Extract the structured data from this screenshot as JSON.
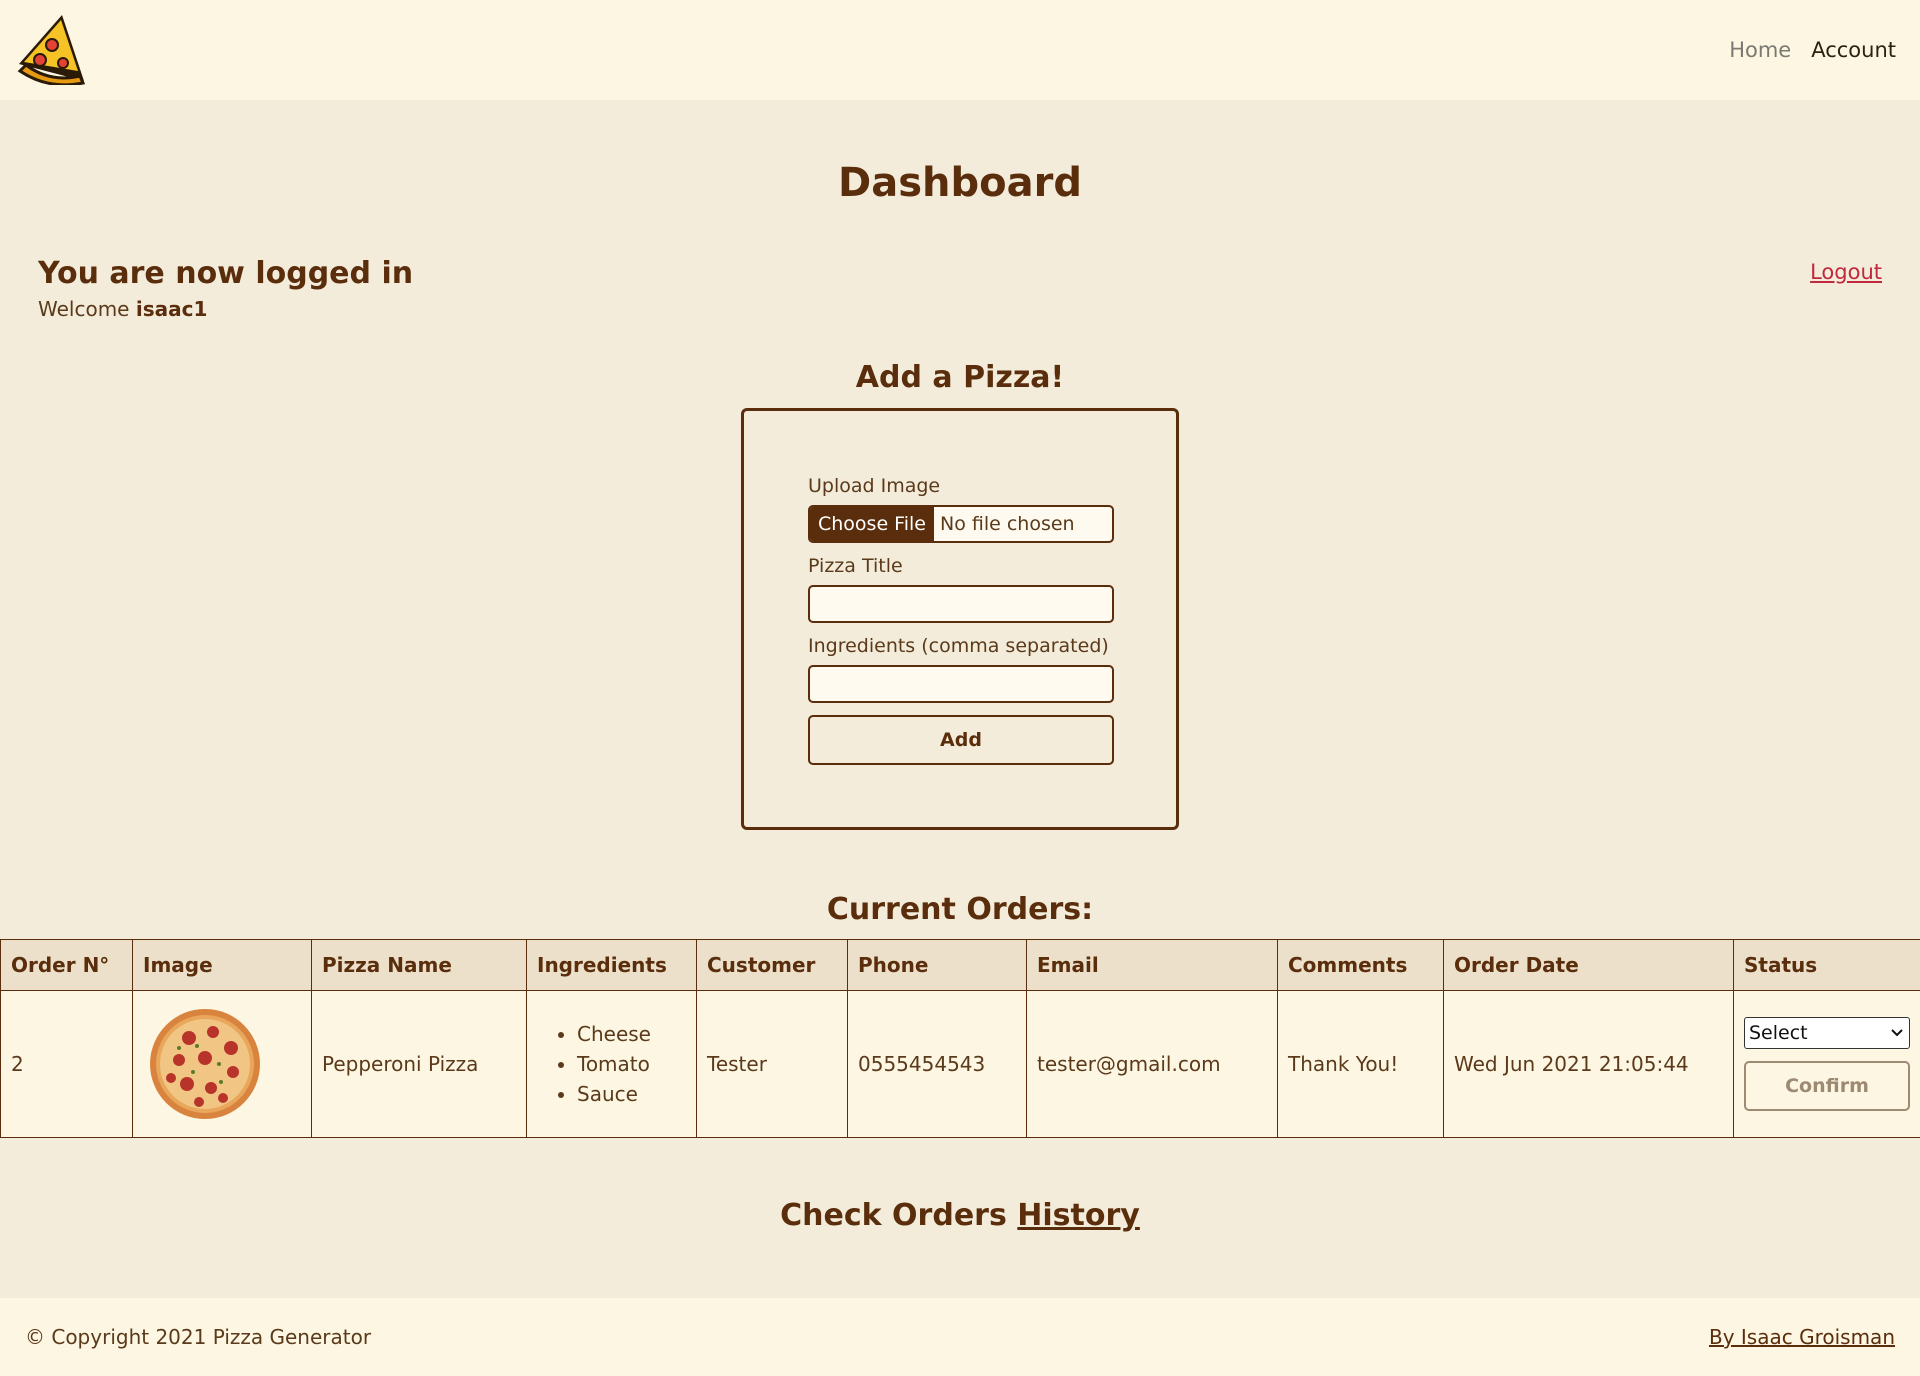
{
  "nav": {
    "home": "Home",
    "account": "Account"
  },
  "page": {
    "title": "Dashboard"
  },
  "login": {
    "heading": "You are now logged in",
    "welcome_prefix": "Welcome ",
    "username": "isaac1",
    "logout": "Logout"
  },
  "add_pizza": {
    "title": "Add a Pizza!",
    "upload_label": "Upload Image",
    "choose_file": "Choose File",
    "no_file": "No file chosen",
    "title_label": "Pizza Title",
    "title_value": "",
    "ingredients_label": "Ingredients (comma separated)",
    "ingredients_value": "",
    "add_button": "Add"
  },
  "orders": {
    "title": "Current Orders:",
    "headers": [
      "Order N°",
      "Image",
      "Pizza Name",
      "Ingredients",
      "Customer",
      "Phone",
      "Email",
      "Comments",
      "Order Date",
      "Status"
    ],
    "rows": [
      {
        "order_no": "2",
        "image": "pepperoni-pizza-image",
        "pizza_name": "Pepperoni Pizza",
        "ingredients": [
          "Cheese",
          "Tomato",
          "Sauce"
        ],
        "customer": "Tester",
        "phone": "0555454543",
        "email": "tester@gmail.com",
        "comments": "Thank You!",
        "order_date": "Wed Jun 2021 21:05:44",
        "status_select": "Select",
        "confirm": "Confirm"
      }
    ]
  },
  "history": {
    "prefix": "Check Orders ",
    "link": "History"
  },
  "footer": {
    "copyright": "© Copyright 2021 Pizza Generator",
    "author": "By Isaac Groisman"
  },
  "colors": {
    "background": "#f4ecda",
    "header_bg": "#fdf6e3",
    "brown": "#5a2e0c",
    "logout_red": "#c0283c",
    "table_header_bg": "#ece0cb"
  }
}
